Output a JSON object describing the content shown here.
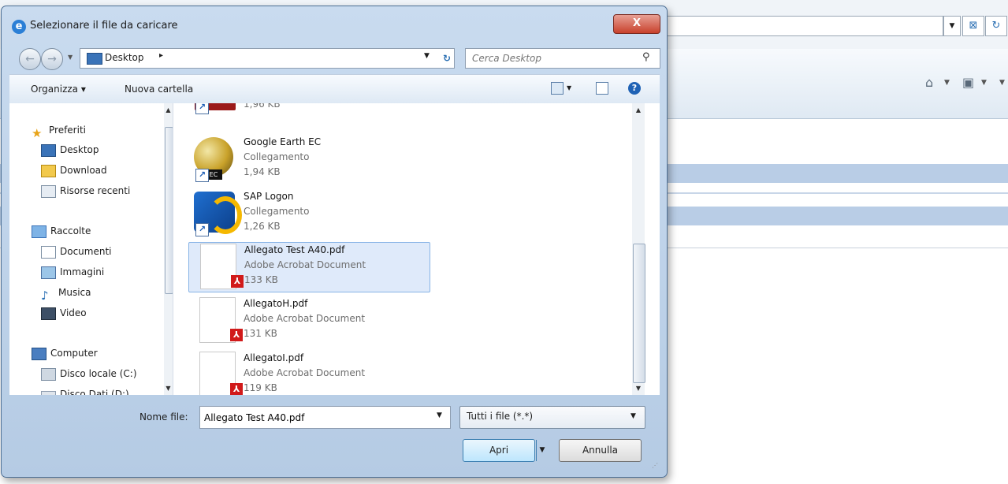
{
  "background_browser": {
    "refresh_glyph": "↻",
    "home_icon": "home-icon",
    "rss_icon": "rss-icon"
  },
  "dialog": {
    "title": "Selezionare il file da caricare",
    "close_label": "X",
    "nav": {
      "path": "Desktop",
      "path_separator": "▸",
      "search_placeholder": "Cerca Desktop"
    },
    "toolbar": {
      "organize_label": "Organizza ▾",
      "new_folder_label": "Nuova cartella",
      "help_label": "?"
    },
    "sidebar": {
      "groups": [
        {
          "label": "Preferiti",
          "items": [
            "Desktop",
            "Download",
            "Risorse recenti"
          ]
        },
        {
          "label": "Raccolte",
          "items": [
            "Documenti",
            "Immagini",
            "Musica",
            "Video"
          ]
        },
        {
          "label": "Computer",
          "items": [
            "Disco locale (C:)",
            "Disco Dati (D:)"
          ]
        }
      ]
    },
    "files": [
      {
        "name": "",
        "type": "",
        "size": "1,96 KB",
        "kind": "shortcut"
      },
      {
        "name": "Google Earth EC",
        "type": "Collegamento",
        "size": "1,94 KB",
        "kind": "shortcut",
        "badge": "EC"
      },
      {
        "name": "SAP Logon",
        "type": "Collegamento",
        "size": "1,26 KB",
        "kind": "shortcut"
      },
      {
        "name": "Allegato Test A40.pdf",
        "type": "Adobe Acrobat Document",
        "size": "133 KB",
        "kind": "pdf",
        "selected": true
      },
      {
        "name": "AllegatoH.pdf",
        "type": "Adobe Acrobat Document",
        "size": "131 KB",
        "kind": "pdf"
      },
      {
        "name": "AllegatoI.pdf",
        "type": "Adobe Acrobat Document",
        "size": "119 KB",
        "kind": "pdf"
      }
    ],
    "bottom": {
      "filename_label": "Nome file:",
      "filename_value": "Allegato Test A40.pdf",
      "filetype_value": "Tutti i file (*.*)",
      "open_label": "Apri",
      "cancel_label": "Annulla"
    }
  },
  "colors": {
    "selection": "#dfeafa",
    "selection_border": "#88b4e6",
    "band": "#b9cde6",
    "close": "#c8412c"
  }
}
